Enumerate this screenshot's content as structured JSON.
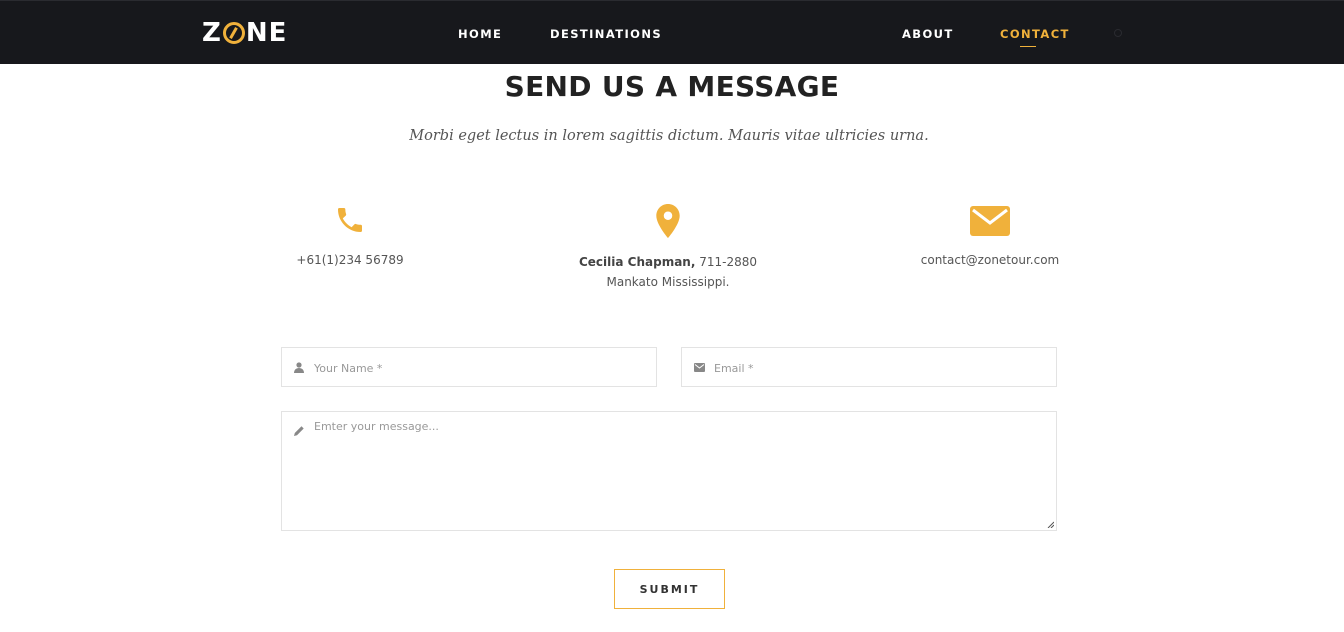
{
  "brand": {
    "logo_left": "Z",
    "logo_right": "NE",
    "accent_color": "#f0b13b",
    "nav_bg": "#17181c"
  },
  "nav": {
    "home": "HOME",
    "destinations": "DESTINATIONS",
    "about": "ABOUT",
    "contact": "CONTACT",
    "active": "contact"
  },
  "section": {
    "title": "SEND US A MESSAGE",
    "subtitle": "Morbi eget lectus in lorem sagittis dictum. Mauris vitae ultricies urna."
  },
  "contact_info": {
    "phone": {
      "icon": "phone-icon",
      "text": "+61(1)234 56789"
    },
    "address": {
      "icon": "map-pin-icon",
      "name": "Cecilia Chapman,",
      "number": " 711-2880",
      "line2": "Mankato Mississippi."
    },
    "email": {
      "icon": "envelope-icon",
      "text": "contact@zonetour.com"
    }
  },
  "form": {
    "name_placeholder": "Your Name *",
    "email_placeholder": "Email *",
    "message_placeholder": "Emter your message...",
    "submit_label": "SUBMIT"
  }
}
